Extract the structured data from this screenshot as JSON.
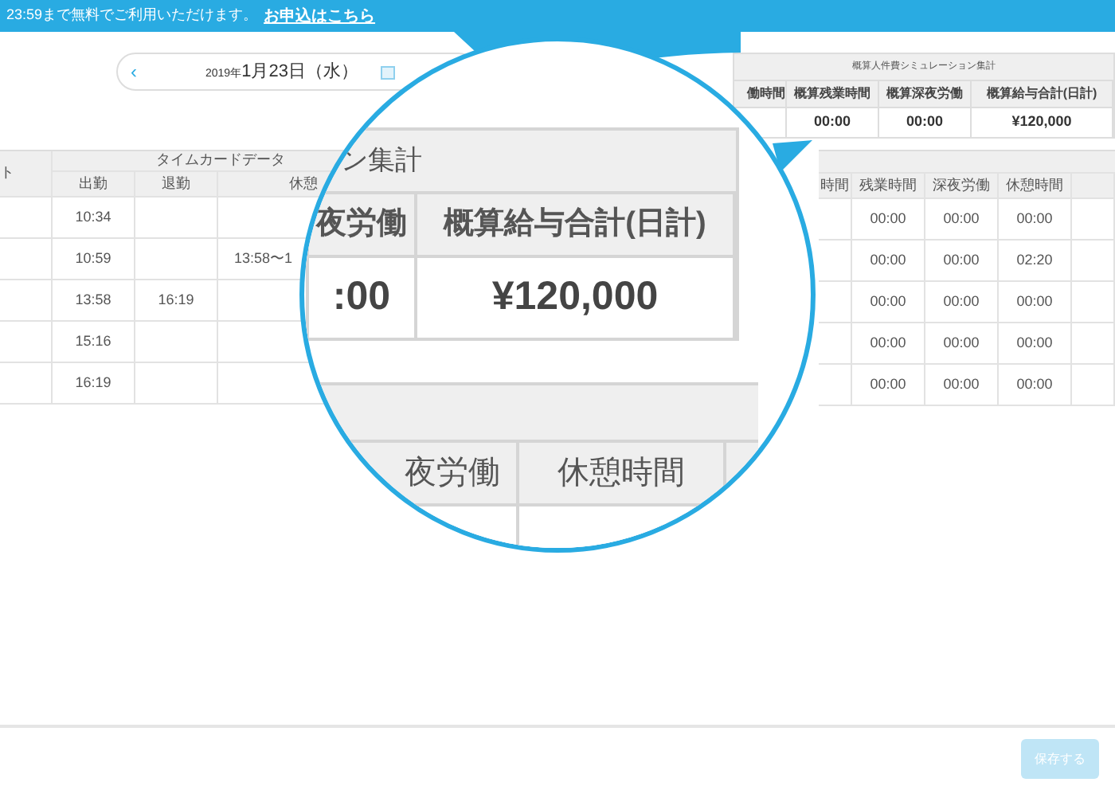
{
  "banner": {
    "text": "23:59まで無料でご利用いただけます。",
    "link": "お申込はこちら"
  },
  "date_nav": {
    "prev": "‹",
    "date_small": "2019年",
    "date": "1月23日（水）"
  },
  "summary": {
    "title": "概算人件費シミュレーション集計",
    "columns": [
      "働時間",
      "概算残業時間",
      "概算深夜労働",
      "概算給与合計(日計)"
    ],
    "values": [
      "00:00",
      "00:00",
      "¥120,000"
    ]
  },
  "left_table": {
    "column_1": "ト",
    "group": "タイムカードデータ",
    "columns": [
      "出勤",
      "退勤",
      "休憩"
    ],
    "rows": [
      [
        "10:34",
        "",
        ""
      ],
      [
        "10:59",
        "",
        "13:58〜1"
      ],
      [
        "13:58",
        "16:19",
        ""
      ],
      [
        "15:16",
        "",
        ""
      ],
      [
        "16:19",
        "",
        ""
      ]
    ]
  },
  "right_table": {
    "columns": [
      "時間",
      "残業時間",
      "深夜労働",
      "休憩時間"
    ],
    "rows": [
      [
        "",
        "00:00",
        "00:00",
        "00:00"
      ],
      [
        "",
        "00:00",
        "00:00",
        "02:20"
      ],
      [
        "",
        "00:00",
        "00:00",
        "00:00"
      ],
      [
        "",
        "00:00",
        "00:00",
        "00:00"
      ],
      [
        "",
        "00:00",
        "00:00",
        "00:00"
      ]
    ]
  },
  "magnifier": {
    "title": "ン集計",
    "columns": [
      "夜労働",
      "概算給与合計(日計)"
    ],
    "values": [
      ":00",
      "¥120,000"
    ],
    "lower_columns": [
      "夜労働",
      "休憩時間"
    ]
  },
  "save_button": {
    "label": "保存する",
    "disabled": true
  }
}
